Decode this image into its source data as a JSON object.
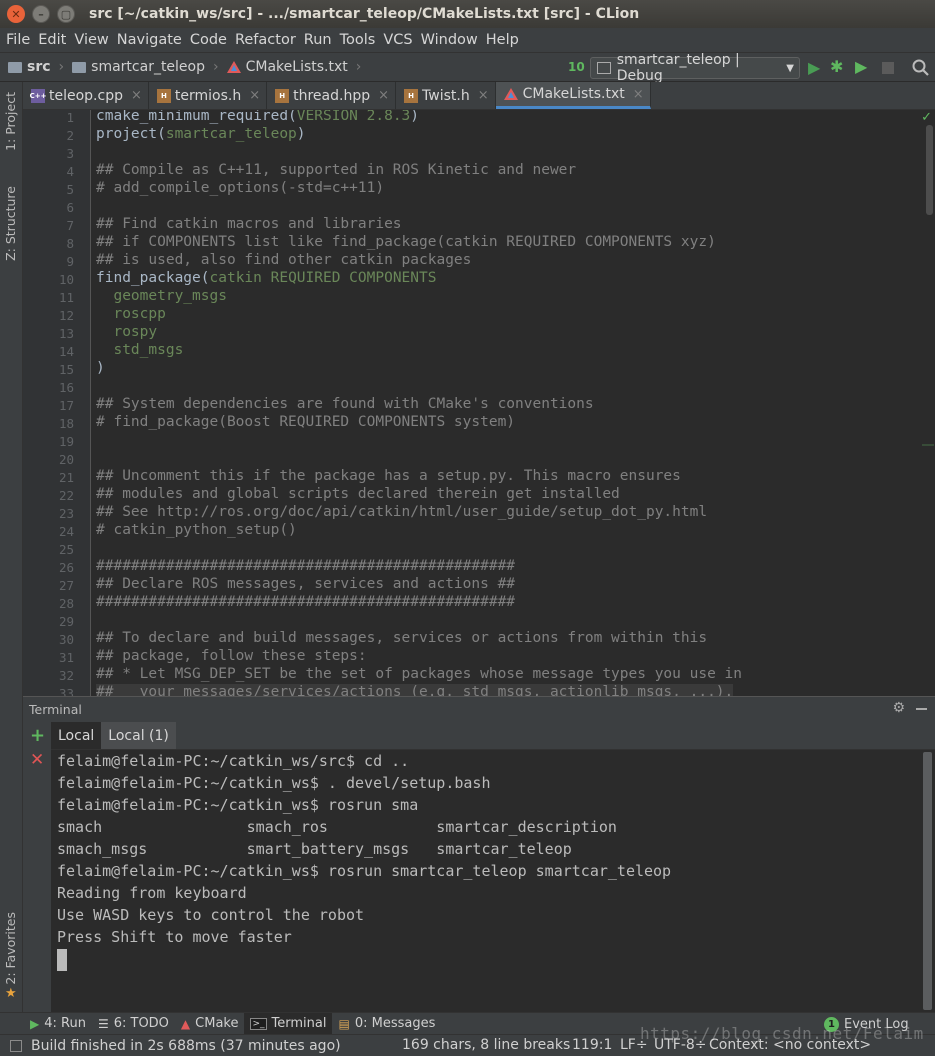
{
  "window": {
    "title": "src [~/catkin_ws/src] - .../smartcar_teleop/CMakeLists.txt [src] - CLion",
    "close_glyph": "✕",
    "minimize_glyph": "–",
    "maximize_glyph": "▢"
  },
  "menu": [
    "File",
    "Edit",
    "View",
    "Navigate",
    "Code",
    "Refactor",
    "Run",
    "Tools",
    "VCS",
    "Window",
    "Help"
  ],
  "breadcrumbs": [
    "src",
    "smartcar_teleop",
    "CMakeLists.txt"
  ],
  "run_config": {
    "label": "smartcar_teleop | Debug",
    "build_glyph": "10",
    "run_glyph": "▶",
    "debug_glyph": "✱",
    "coverage_glyph": "▶"
  },
  "left_tabs": [
    "1: Project",
    "Z: Structure",
    "2: Favorites"
  ],
  "editor_tabs": [
    {
      "label": "teleop.cpp",
      "icon": "cpp-file-icon",
      "badge": "C++"
    },
    {
      "label": "termios.h",
      "icon": "header-file-icon",
      "badge": "H"
    },
    {
      "label": "thread.hpp",
      "icon": "header-file-icon",
      "badge": "H"
    },
    {
      "label": "Twist.h",
      "icon": "header-file-icon",
      "badge": "H"
    },
    {
      "label": "CMakeLists.txt",
      "icon": "cmake-icon",
      "active": true
    }
  ],
  "editor": {
    "status_glyph": "✓",
    "line_numbers": [
      "1",
      "2",
      "3",
      "4",
      "5",
      "6",
      "7",
      "8",
      "9",
      "10",
      "11",
      "12",
      "13",
      "14",
      "15",
      "16",
      "17",
      "18",
      "19",
      "20",
      "21",
      "22",
      "23",
      "24",
      "25",
      "26",
      "27",
      "28",
      "29",
      "30",
      "31",
      "32",
      "33"
    ],
    "lines": [
      {
        "kind": "call",
        "fn": "cmake_minimum_required(",
        "arg": "VERSION 2.8.3",
        "end": ")"
      },
      {
        "kind": "call",
        "fn": "project(",
        "arg": "smartcar_teleop",
        "end": ")"
      },
      {
        "kind": "blank",
        "text": ""
      },
      {
        "kind": "comment",
        "text": "## Compile as C++11, supported in ROS Kinetic and newer"
      },
      {
        "kind": "comment",
        "text": "# add_compile_options(-std=c++11)"
      },
      {
        "kind": "blank",
        "text": ""
      },
      {
        "kind": "comment",
        "text": "## Find catkin macros and libraries"
      },
      {
        "kind": "comment",
        "text": "## if COMPONENTS list like find_package(catkin REQUIRED COMPONENTS xyz)"
      },
      {
        "kind": "comment",
        "text": "## is used, also find other catkin packages"
      },
      {
        "kind": "call",
        "fn": "find_package(",
        "arg": "catkin REQUIRED COMPONENTS",
        "end": ""
      },
      {
        "kind": "arg",
        "text": "  geometry_msgs"
      },
      {
        "kind": "arg",
        "text": "  roscpp"
      },
      {
        "kind": "arg",
        "text": "  rospy"
      },
      {
        "kind": "arg",
        "text": "  std_msgs"
      },
      {
        "kind": "code",
        "text": ")"
      },
      {
        "kind": "blank",
        "text": ""
      },
      {
        "kind": "comment",
        "text": "## System dependencies are found with CMake's conventions"
      },
      {
        "kind": "comment",
        "text": "# find_package(Boost REQUIRED COMPONENTS system)"
      },
      {
        "kind": "blank",
        "text": ""
      },
      {
        "kind": "blank",
        "text": ""
      },
      {
        "kind": "comment",
        "text": "## Uncomment this if the package has a setup.py. This macro ensures"
      },
      {
        "kind": "comment",
        "text": "## modules and global scripts declared therein get installed"
      },
      {
        "kind": "comment",
        "text": "## See http://ros.org/doc/api/catkin/html/user_guide/setup_dot_py.html"
      },
      {
        "kind": "comment",
        "text": "# catkin_python_setup()"
      },
      {
        "kind": "blank",
        "text": ""
      },
      {
        "kind": "comment",
        "text": "################################################"
      },
      {
        "kind": "comment",
        "text": "## Declare ROS messages, services and actions ##"
      },
      {
        "kind": "comment",
        "text": "################################################"
      },
      {
        "kind": "blank",
        "text": ""
      },
      {
        "kind": "comment",
        "text": "## To declare and build messages, services or actions from within this"
      },
      {
        "kind": "comment",
        "text": "## package, follow these steps:"
      },
      {
        "kind": "comment",
        "text": "## * Let MSG_DEP_SET be the set of packages whose message types you use in"
      },
      {
        "kind": "comment",
        "text": "##   your messages/services/actions (e.g. std_msgs, actionlib_msgs, ...)."
      }
    ]
  },
  "terminal": {
    "title": "Terminal",
    "add_glyph": "+",
    "close_glyph": "✕",
    "settings_glyph": "⚙",
    "tabs": [
      "Local",
      "Local (1)"
    ],
    "lines": [
      "felaim@felaim-PC:~/catkin_ws/src$ cd ..",
      "felaim@felaim-PC:~/catkin_ws$ . devel/setup.bash",
      "felaim@felaim-PC:~/catkin_ws$ rosrun sma",
      "smach                smach_ros            smartcar_description",
      "smach_msgs           smart_battery_msgs   smartcar_teleop",
      "felaim@felaim-PC:~/catkin_ws$ rosrun smartcar_teleop smartcar_teleop",
      "Reading from keyboard",
      "Use WASD keys to control the robot",
      "Press Shift to move faster"
    ]
  },
  "bottom_tools": [
    {
      "label": "4: Run",
      "icon": "run-icon",
      "glyph": "▶"
    },
    {
      "label": "6: TODO",
      "icon": "todo-icon",
      "glyph": "☰"
    },
    {
      "label": "CMake",
      "icon": "cmake-icon",
      "glyph": "▲"
    },
    {
      "label": "Terminal",
      "icon": "terminal-icon",
      "glyph": ">_",
      "active": true
    },
    {
      "label": "0: Messages",
      "icon": "messages-icon",
      "glyph": "▤"
    }
  ],
  "event_log": {
    "label": "Event Log",
    "badge": "1"
  },
  "status": {
    "message": "Build finished in 2s 688ms (37 minutes ago)",
    "chars": "169 chars, 8 line breaks",
    "position": "119:1",
    "line_sep": "LF÷",
    "encoding": "UTF-8÷",
    "context": "Context: <no context>"
  },
  "watermark": "https://blog.csdn.net/Felaim"
}
